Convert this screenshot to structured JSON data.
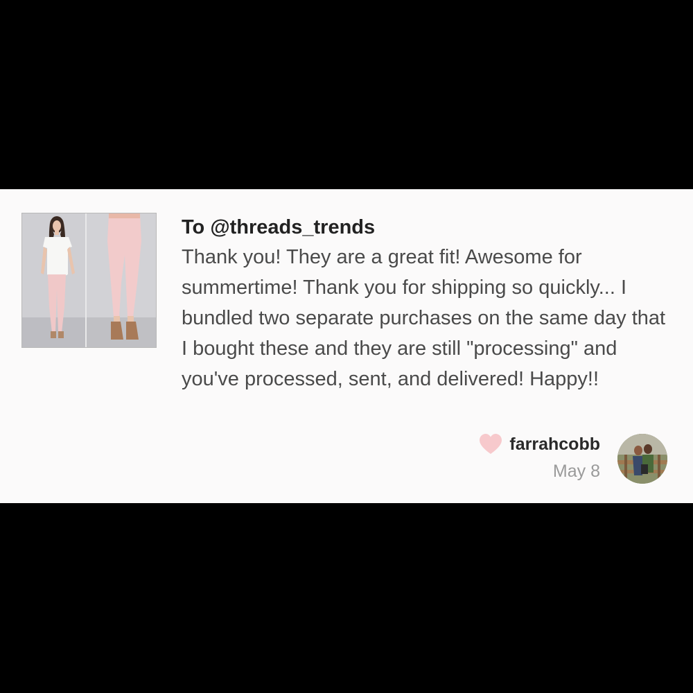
{
  "review": {
    "recipient": "To @threads_trends",
    "text": "Thank you! They are a great fit! Awesome for summertime! Thank you for shipping so quickly... I bundled two separate purchases on the same day that I bought these and they are still \"processing\" and you've processed, sent, and delivered! Happy!!",
    "author": "farrahcobb",
    "date": "May 8"
  },
  "icons": {
    "like": "heart-icon",
    "product": "product-thumbnail",
    "user": "avatar"
  },
  "colors": {
    "heart": "#f7c9cc",
    "card_background": "#fbfafa",
    "page_background": "#000000",
    "text": "#4a4a4a",
    "date": "#9a9a9a"
  }
}
